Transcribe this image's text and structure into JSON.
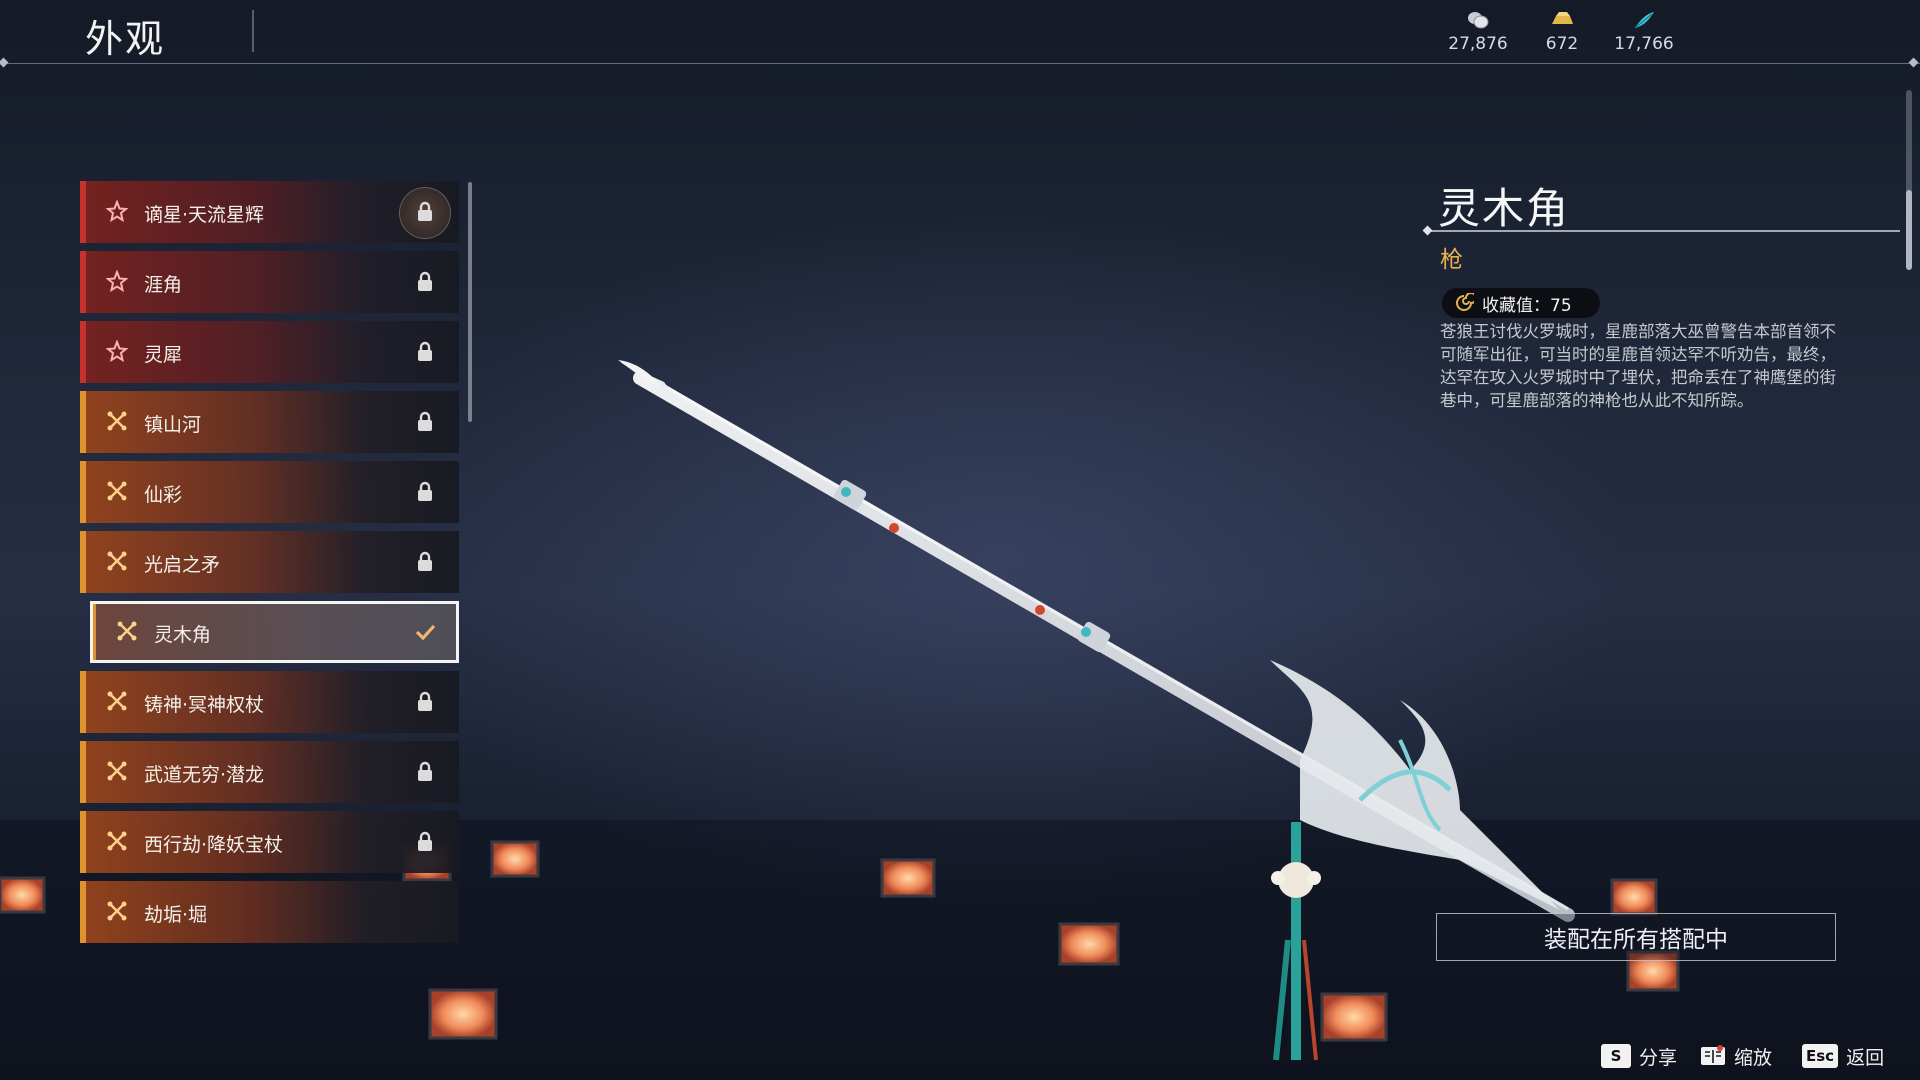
{
  "header": {
    "title": "外观",
    "currencies": [
      {
        "icon": "coin-stack-icon",
        "value": "27,876"
      },
      {
        "icon": "gold-ingot-icon",
        "value": "672"
      },
      {
        "icon": "feather-icon",
        "value": "17,766"
      }
    ]
  },
  "list": {
    "items": [
      {
        "label": "谪星·天流星辉",
        "rarity": "red",
        "icon": "star-flower-icon",
        "state": "locked"
      },
      {
        "label": "涯角",
        "rarity": "red",
        "icon": "star-flower-icon",
        "state": "locked"
      },
      {
        "label": "灵犀",
        "rarity": "red",
        "icon": "star-flower-icon",
        "state": "locked"
      },
      {
        "label": "镇山河",
        "rarity": "gold",
        "icon": "cross-knot-icon",
        "state": "locked"
      },
      {
        "label": "仙彩",
        "rarity": "gold",
        "icon": "cross-knot-icon",
        "state": "locked"
      },
      {
        "label": "光启之矛",
        "rarity": "gold",
        "icon": "cross-knot-icon",
        "state": "locked"
      },
      {
        "label": "灵木角",
        "rarity": "gold",
        "icon": "cross-knot-icon",
        "state": "equipped"
      },
      {
        "label": "铸神·冥神权杖",
        "rarity": "gold",
        "icon": "cross-knot-icon",
        "state": "locked"
      },
      {
        "label": "武道无穷·潜龙",
        "rarity": "gold",
        "icon": "cross-knot-icon",
        "state": "locked"
      },
      {
        "label": "西行劫·降妖宝杖",
        "rarity": "gold",
        "icon": "cross-knot-icon",
        "state": "locked"
      },
      {
        "label": "劫垢·堀",
        "rarity": "gold",
        "icon": "cross-knot-icon",
        "state": "none"
      }
    ],
    "selected_index": 6
  },
  "detail": {
    "name": "灵木角",
    "type": "枪",
    "collection": "收藏值：75",
    "description": "苍狼王讨伐火罗城时，星鹿部落大巫曾警告本部首领不可随军出征，可当时的星鹿首领达罕不听劝告，最终，达罕在攻入火罗城时中了埋伏，把命丢在了神鹰堡的街巷中，可星鹿部落的神枪也从此不知所踪。",
    "equip_button": "装配在所有搭配中"
  },
  "hints": [
    {
      "key": "S",
      "label": "分享"
    },
    {
      "key": "",
      "key_icon": "book-icon",
      "label": "缩放"
    },
    {
      "key": "Esc",
      "label": "返回"
    }
  ],
  "colors": {
    "rarity_red": "#c8322e",
    "rarity_gold": "#e0922e",
    "type_text": "#e6b24a",
    "selected_outline": "#f4f4f4"
  }
}
